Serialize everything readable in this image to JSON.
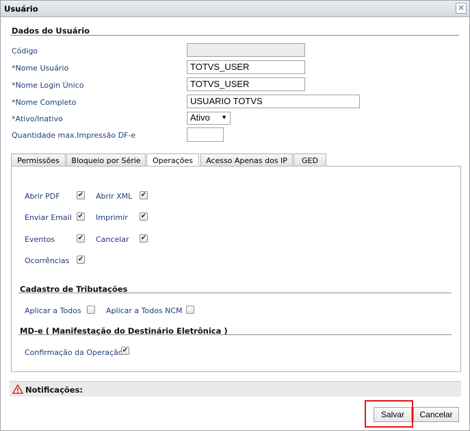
{
  "window": {
    "title": "Usuário",
    "close": "×"
  },
  "user_section": {
    "heading": "Dados do Usuário",
    "fields": {
      "codigo": {
        "label": "Código",
        "value": ""
      },
      "nome_usuario": {
        "label": "*Nome Usuário",
        "value": "TOTVS_USER"
      },
      "nome_login": {
        "label": "*Nome Login Único",
        "value": "TOTVS_USER"
      },
      "nome_completo": {
        "label": "*Nome Completo",
        "value": "USUARIO TOTVS"
      },
      "ativo": {
        "label": "*Ativo/Inativo",
        "value": "Ativo"
      },
      "qtd_impressao": {
        "label": "Quantidade max.Impressão DF-e",
        "value": ""
      }
    }
  },
  "tabs": [
    {
      "label": "Permissões",
      "active": false
    },
    {
      "label": "Bloqueio por Série",
      "active": false
    },
    {
      "label": "Operações",
      "active": true
    },
    {
      "label": "Acesso Apenas dos IP",
      "active": false
    },
    {
      "label": "GED",
      "active": false
    }
  ],
  "operations": {
    "abrir_pdf": {
      "label": "Abrir PDF",
      "checked": true
    },
    "abrir_xml": {
      "label": "Abrir XML",
      "checked": true
    },
    "enviar_email": {
      "label": "Enviar Email",
      "checked": true
    },
    "imprimir": {
      "label": "Imprimir",
      "checked": true
    },
    "eventos": {
      "label": "Eventos",
      "checked": true
    },
    "cancelar": {
      "label": "Cancelar",
      "checked": true
    },
    "ocorrencias": {
      "label": "Ocorrências",
      "checked": true
    }
  },
  "tributacoes": {
    "heading": "Cadastro de Tributações",
    "aplicar_todos": {
      "label": "Aplicar a Todos",
      "checked": false
    },
    "aplicar_todos_ncm": {
      "label": "Aplicar a Todos NCM",
      "checked": false
    }
  },
  "mde": {
    "heading": "MD-e ( Manifestação do Destinário Eletrônica )",
    "confirmacao": {
      "label": "Confirmação da Operação",
      "checked": true
    }
  },
  "notifications": {
    "label": "Notificações:"
  },
  "buttons": {
    "save": "Salvar",
    "cancel": "Cancelar"
  },
  "colors": {
    "highlight": "#e01515",
    "label_blue": "#1f3a7a",
    "warning": "#d9261c"
  }
}
